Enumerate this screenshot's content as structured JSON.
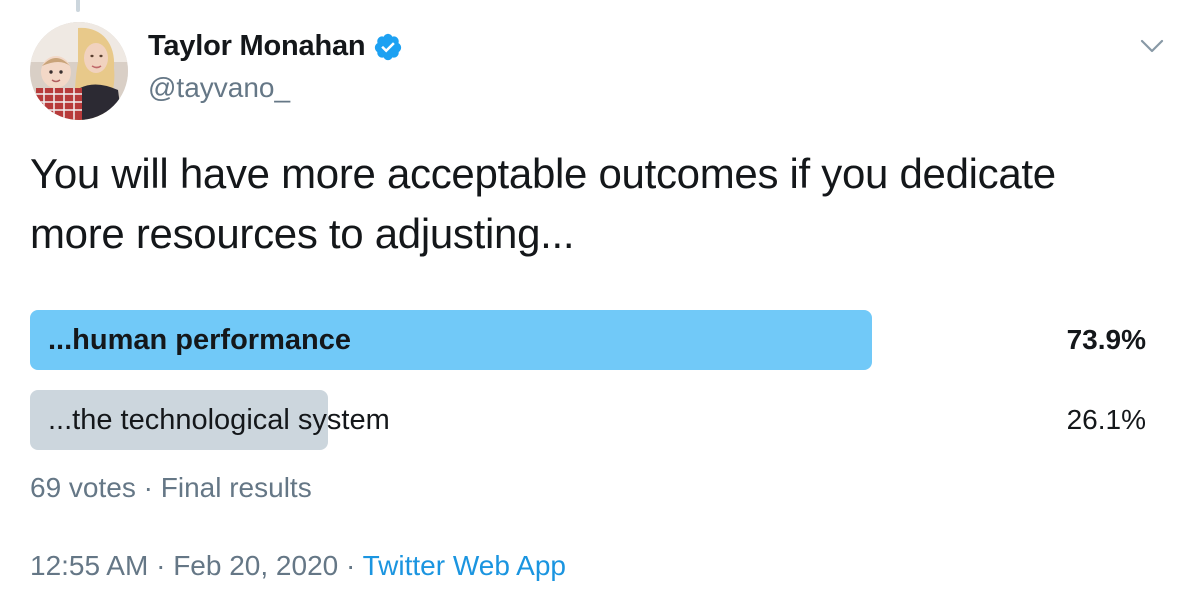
{
  "author": {
    "display_name": "Taylor Monahan",
    "handle": "@tayvano_",
    "verified": true
  },
  "tweet": {
    "text_line1": "You will have more acceptable outcomes if you dedicate",
    "text_line2": "more resources to adjusting..."
  },
  "poll": {
    "choices": [
      {
        "label": "...human performance",
        "percent_text": "73.9%",
        "percent": 73.9,
        "winner": true
      },
      {
        "label": "...the technological system",
        "percent_text": "26.1%",
        "percent": 26.1,
        "winner": false
      }
    ],
    "votes": "69 votes",
    "separator": "·",
    "status": "Final results"
  },
  "meta": {
    "time": "12:55 AM",
    "separator": "·",
    "date": "Feb 20, 2020",
    "source": "Twitter Web App"
  },
  "colors": {
    "winner_bar": "#71c9f8",
    "loser_bar": "#ccd6dd",
    "verified": "#1da1f2",
    "link": "#1b95e0",
    "muted": "#657786"
  },
  "icons": {
    "verified": "verified-badge-icon",
    "menu": "chevron-down-icon"
  }
}
